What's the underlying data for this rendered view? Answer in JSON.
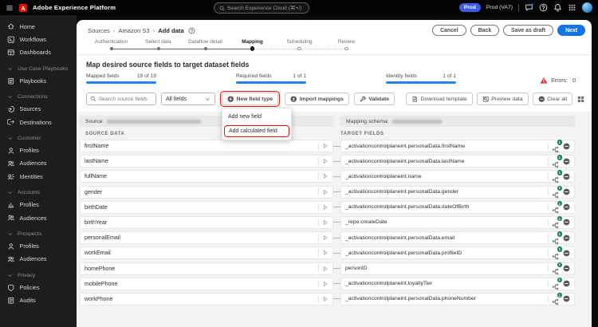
{
  "colors": {
    "accent_blue": "#1473e6",
    "progress_blue": "#2680eb",
    "env_badge_blue": "#3d5be8",
    "annotation_red": "#ec1000",
    "error_red": "#d7373f",
    "badge_green": "#12805c"
  },
  "topbar": {
    "brand": "Adobe Experience Platform",
    "search_placeholder": "Search Experience Cloud (⌘+/)",
    "env_badge": "Prod",
    "env_name": "Prod (VA7)"
  },
  "sidebar": {
    "items": [
      {
        "kind": "nav",
        "icon": "home",
        "label": "Home"
      },
      {
        "kind": "nav",
        "icon": "workflows",
        "label": "Workflows"
      },
      {
        "kind": "nav",
        "icon": "dashboards",
        "label": "Dashboards"
      },
      {
        "kind": "section",
        "icon": "chevron-down",
        "label": "Use Case Playbooks"
      },
      {
        "kind": "nav",
        "icon": "playbooks",
        "label": "Playbooks"
      },
      {
        "kind": "section",
        "icon": "chevron-down",
        "label": "Connections"
      },
      {
        "kind": "nav",
        "icon": "sources",
        "label": "Sources"
      },
      {
        "kind": "nav",
        "icon": "destinations",
        "label": "Destinations"
      },
      {
        "kind": "section",
        "icon": "chevron-down",
        "label": "Customer"
      },
      {
        "kind": "nav",
        "icon": "profile",
        "label": "Profiles"
      },
      {
        "kind": "nav",
        "icon": "audiences",
        "label": "Audiences"
      },
      {
        "kind": "nav",
        "icon": "identities",
        "label": "Identities"
      },
      {
        "kind": "section",
        "icon": "chevron-down",
        "label": "Accounts"
      },
      {
        "kind": "nav",
        "icon": "accounts",
        "label": "Profiles"
      },
      {
        "kind": "nav",
        "icon": "audiences",
        "label": "Audiences"
      },
      {
        "kind": "section",
        "icon": "chevron-down",
        "label": "Prospects"
      },
      {
        "kind": "nav",
        "icon": "profile",
        "label": "Profiles"
      },
      {
        "kind": "nav",
        "icon": "audiences",
        "label": "Audiences"
      },
      {
        "kind": "section",
        "icon": "chevron-down",
        "label": "Privacy"
      },
      {
        "kind": "nav",
        "icon": "policies",
        "label": "Policies"
      },
      {
        "kind": "nav",
        "icon": "audits",
        "label": "Audits"
      }
    ]
  },
  "breadcrumb": {
    "items": [
      "Sources",
      "Amazon S3",
      "Add data"
    ]
  },
  "actions": {
    "cancel": "Cancel",
    "back": "Back",
    "save_draft": "Save as draft",
    "next": "Next"
  },
  "wizard": {
    "steps": [
      {
        "label": "Authentication",
        "state": "done"
      },
      {
        "label": "Select data",
        "state": "done"
      },
      {
        "label": "Dataflow detail",
        "state": "done"
      },
      {
        "label": "Mapping",
        "state": "current"
      },
      {
        "label": "Scheduling",
        "state": "todo"
      },
      {
        "label": "Review",
        "state": "todo"
      }
    ]
  },
  "mapping": {
    "title": "Map desired source fields to target dataset fields",
    "stats": [
      {
        "label": "Mapped fields",
        "value": "19 of 19",
        "pct": 100
      },
      {
        "label": "Required fields",
        "value": "1 of 1",
        "pct": 100
      },
      {
        "label": "Identity fields",
        "value": "1 of 1",
        "pct": 100
      }
    ],
    "errors": {
      "label": "Errors:",
      "count": "0"
    },
    "toolbar": {
      "search_placeholder": "Search source fields",
      "filter_value": "All fields",
      "new_field_type": "New field type",
      "import_mappings": "Import mappings",
      "validate": "Validate",
      "download_template": "Download template",
      "preview_data": "Preview data",
      "clear_all": "Clear all"
    },
    "menu": {
      "items": [
        {
          "label": "Add new field",
          "cls": "plain"
        },
        {
          "label": "Add calculated field",
          "cls": "hl"
        }
      ]
    },
    "header": {
      "source_label": "Source:",
      "schema_label": "Mapping schema:",
      "source_col": "SOURCE DATA",
      "target_col": "TARGET FIELDS"
    },
    "rows": [
      {
        "source": "firstName",
        "target": "_activationcontrolplaneint.personalData.firstName",
        "badge": "1"
      },
      {
        "source": "lastName",
        "target": "_activationcontrolplaneint.personalData.lastName",
        "badge": "1"
      },
      {
        "source": "fullName",
        "target": "_activationcontrolplaneint.name",
        "badge": "1"
      },
      {
        "source": "gender",
        "target": "_activationcontrolplaneint.personalData.gender",
        "badge": "1"
      },
      {
        "source": "birthDate",
        "target": "_activationcontrolplaneint.personalData.dateOfBirth",
        "badge": "1"
      },
      {
        "source": "birthYear",
        "target": "_repo.createDate",
        "badge": "1"
      },
      {
        "source": "personalEmail",
        "target": "_activationcontrolplaneint.personalData.email",
        "badge": "1"
      },
      {
        "source": "workEmail",
        "target": "_activationcontrolplaneint.personalData.profileID",
        "badge": "1"
      },
      {
        "source": "homePhone",
        "target": "personID",
        "badge": "1"
      },
      {
        "source": "mobilePhone",
        "target": "_activationcontrolplaneint.loyaltyTier",
        "badge": "1"
      },
      {
        "source": "workPhone",
        "target": "_activationcontrolplaneint.personalData.phoneNumber",
        "badge": "1"
      }
    ]
  }
}
